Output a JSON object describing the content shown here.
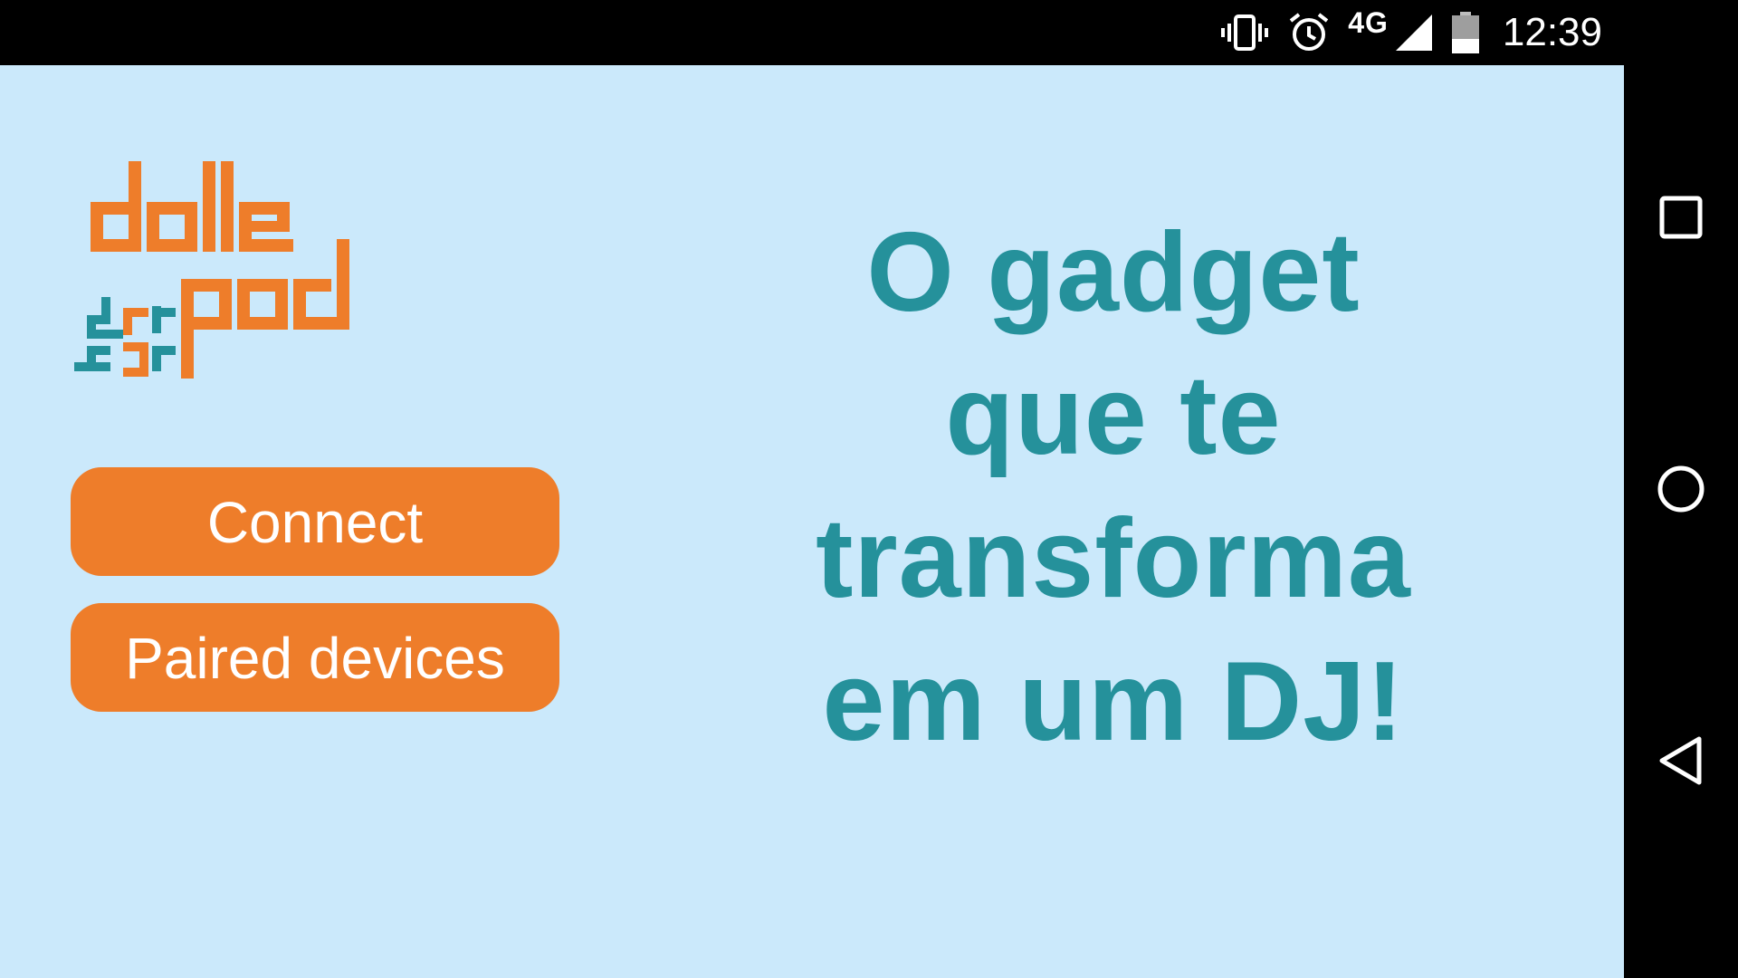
{
  "status_bar": {
    "network": "4G",
    "time": "12:39",
    "icons": [
      "vibrate-icon",
      "alarm-icon",
      "signal-icon",
      "battery-icon"
    ]
  },
  "app": {
    "background_color": "#CBE9FB",
    "accent_color": "#EE7D2A",
    "secondary_color": "#25919B",
    "logo": {
      "text": "dalle da pad"
    },
    "buttons": {
      "connect_label": "Connect",
      "paired_label": "Paired devices"
    },
    "tagline": {
      "line1": "O gadget",
      "line2": "que te",
      "line3": "transforma",
      "line4": "em um DJ!"
    }
  },
  "nav_bar": {
    "icons": [
      "recents-icon",
      "home-icon",
      "back-icon"
    ]
  }
}
